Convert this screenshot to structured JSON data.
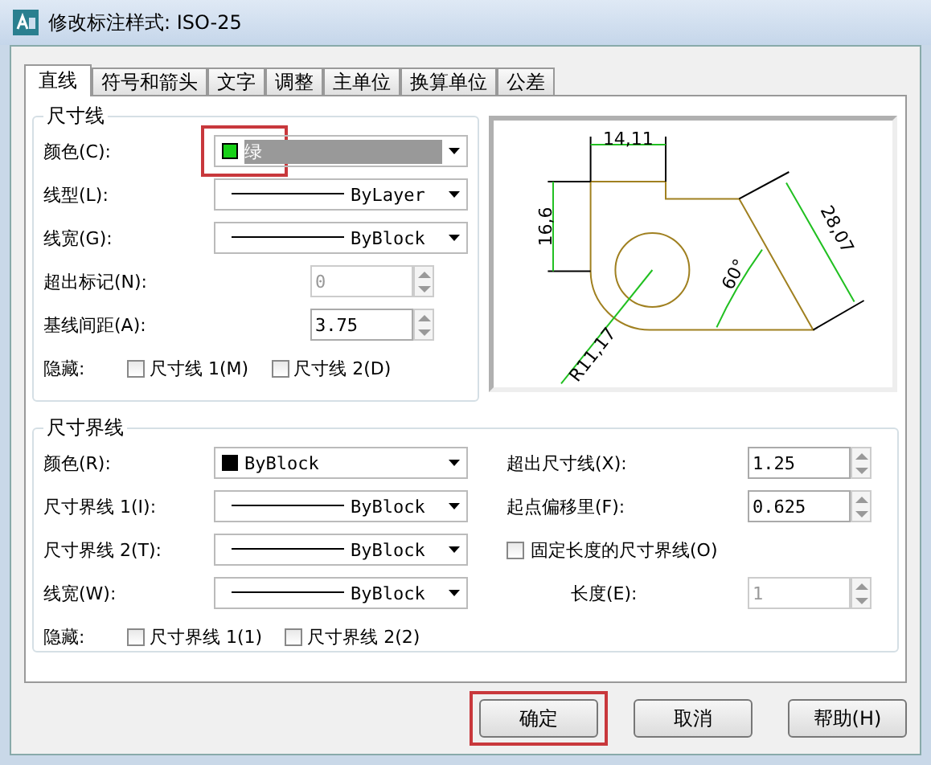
{
  "window": {
    "title": "修改标注样式: ISO-25"
  },
  "tabs": [
    {
      "label": "直线",
      "selected": true
    },
    {
      "label": "符号和箭头",
      "selected": false
    },
    {
      "label": "文字",
      "selected": false
    },
    {
      "label": "调整",
      "selected": false
    },
    {
      "label": "主单位",
      "selected": false
    },
    {
      "label": "换算单位",
      "selected": false
    },
    {
      "label": "公差",
      "selected": false
    }
  ],
  "dimension_lines": {
    "title": "尺寸线",
    "rows": [
      {
        "kind": "color",
        "label": "颜色(C):",
        "value": "绿",
        "color": "#18d018",
        "focused": true,
        "highlighted": true
      },
      {
        "kind": "line",
        "label": "线型(L):",
        "value": "ByLayer"
      },
      {
        "kind": "line",
        "label": "线宽(G):",
        "value": "ByBlock"
      },
      {
        "kind": "spin",
        "label": "超出标记(N):",
        "value": "0",
        "disabled": true
      },
      {
        "kind": "spin",
        "label": "基线间距(A):",
        "value": "3.75",
        "disabled": false
      }
    ],
    "hide": {
      "label": "隐藏:",
      "checkboxes": [
        {
          "label": "尺寸线 1(M)",
          "checked": false
        },
        {
          "label": "尺寸线 2(D)",
          "checked": false
        }
      ]
    }
  },
  "preview": {
    "labels": [
      "14,11",
      "16,6",
      "28,07",
      "60°",
      "R11,17"
    ]
  },
  "extension_lines": {
    "title": "尺寸界线",
    "rows": [
      {
        "kind": "color",
        "label": "颜色(R):",
        "value": "ByBlock",
        "color": "#000000",
        "focused": false,
        "highlighted": false
      },
      {
        "kind": "line",
        "label": "尺寸界线 1(I):",
        "value": "ByBlock"
      },
      {
        "kind": "line",
        "label": "尺寸界线 2(T):",
        "value": "ByBlock"
      },
      {
        "kind": "line",
        "label": "线宽(W):",
        "value": "ByBlock"
      }
    ],
    "hide": {
      "label": "隐藏:",
      "checkboxes": [
        {
          "label": "尺寸界线 1(1)",
          "checked": false
        },
        {
          "label": "尺寸界线 2(2)",
          "checked": false
        }
      ]
    },
    "right_rows": [
      {
        "kind": "spin",
        "label": "超出尺寸线(X):",
        "value": "1.25",
        "disabled": false
      },
      {
        "kind": "spin",
        "label": "起点偏移里(F):",
        "value": "0.625",
        "disabled": false
      },
      {
        "kind": "check",
        "label": "固定长度的尺寸界线(O)",
        "checked": false
      },
      {
        "kind": "spin",
        "label": "长度(E):",
        "value": "1",
        "disabled": true
      }
    ]
  },
  "buttons": [
    {
      "label": "确定",
      "highlighted": true
    },
    {
      "label": "取消",
      "highlighted": false
    },
    {
      "label": "帮助(H)",
      "highlighted": false
    }
  ]
}
